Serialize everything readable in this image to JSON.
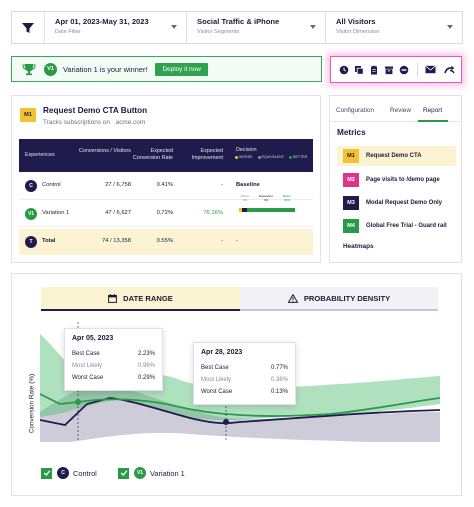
{
  "filters": {
    "date": {
      "value": "Apr 01, 2023-May 31, 2023",
      "label": "Date Filter"
    },
    "segment": {
      "value": "Social Traffic & iPhone",
      "label": "Visitor Segments"
    },
    "dimension": {
      "value": "All Visitors",
      "label": "Visitor Dimension"
    }
  },
  "winner": {
    "badge": "V1",
    "text": "Variation 1 is your winner!",
    "button": "Deploy it now"
  },
  "toolbar": {
    "icons": [
      "clock-icon",
      "copy-icon",
      "clipboard-icon",
      "archive-icon",
      "stop-icon",
      "mail-icon",
      "share-icon"
    ]
  },
  "experiment": {
    "badge": "M1",
    "title": "Request Demo CTA Button",
    "subtitle": "Tracks subscriptions on",
    "url": "acme.com",
    "headers": {
      "experiences": "Experiences",
      "conversions": "Conversions / Visitors",
      "rate": "Expected Conversion Rate",
      "improvement": "Expected Improvement",
      "decision": "Decision"
    },
    "decision_legend": [
      "WORSE",
      "EQUIVALENT",
      "BETTER"
    ],
    "rows": [
      {
        "badge": "C",
        "name": "Control",
        "conversions": "27 / 6,758",
        "rate": "0.41%",
        "improvement": "-",
        "decision": "Baseline"
      },
      {
        "badge": "V1",
        "name": "Variation 1",
        "conversions": "47 / 6,627",
        "rate": "0.72%",
        "improvement": "76.16%",
        "decision": ""
      },
      {
        "badge": "T",
        "name": "Total",
        "conversions": "74 / 13,358",
        "rate": "0.55%",
        "improvement": "-",
        "decision": "-"
      }
    ],
    "decision_bar": {
      "worse": "Worse",
      "worse_value": "0%",
      "equivalent": "Equivalent",
      "equivalent_value": "4%",
      "better": "Better",
      "better_value": "96%"
    }
  },
  "side": {
    "tabs": [
      "Configuration",
      "Review",
      "Report"
    ],
    "active_tab": "Report",
    "metrics_title": "Metrics",
    "metrics": [
      {
        "badge": "M1",
        "label": "Request Demo CTA",
        "color": "#f2c230"
      },
      {
        "badge": "M2",
        "label": "Page visits to /demo page",
        "color": "#e0338c"
      },
      {
        "badge": "M3",
        "label": "Modal Request Demo Only",
        "color": "#201b4d"
      },
      {
        "badge": "M4",
        "label": "Global Free Trial - Guard rail",
        "color": "#2b9a48"
      }
    ],
    "heatmaps": "Heatmaps"
  },
  "chart": {
    "tabs": {
      "date_range": "DATE RANGE",
      "probability": "PROBABILITY DENSITY"
    },
    "ylabel": "Conversion Rate (%)",
    "tooltips": [
      {
        "date": "Apr 05, 2023",
        "rows": [
          {
            "label": "Best Case",
            "value": "2.23%"
          },
          {
            "label": "Most Likely",
            "value": "0.96%"
          },
          {
            "label": "Worst Case",
            "value": "0.29%"
          }
        ]
      },
      {
        "date": "Apr 28, 2023",
        "rows": [
          {
            "label": "Best Case",
            "value": "0.77%"
          },
          {
            "label": "Most Likely",
            "value": "0.36%"
          },
          {
            "label": "Worst Case",
            "value": "0.13%"
          }
        ]
      }
    ],
    "legend": [
      {
        "badge": "C",
        "label": "Control"
      },
      {
        "badge": "V1",
        "label": "Variation 1"
      }
    ]
  },
  "colors": {
    "navy": "#201b4d",
    "green": "#2b9a48",
    "yellow": "#f2c230",
    "pink": "#e0338c"
  }
}
